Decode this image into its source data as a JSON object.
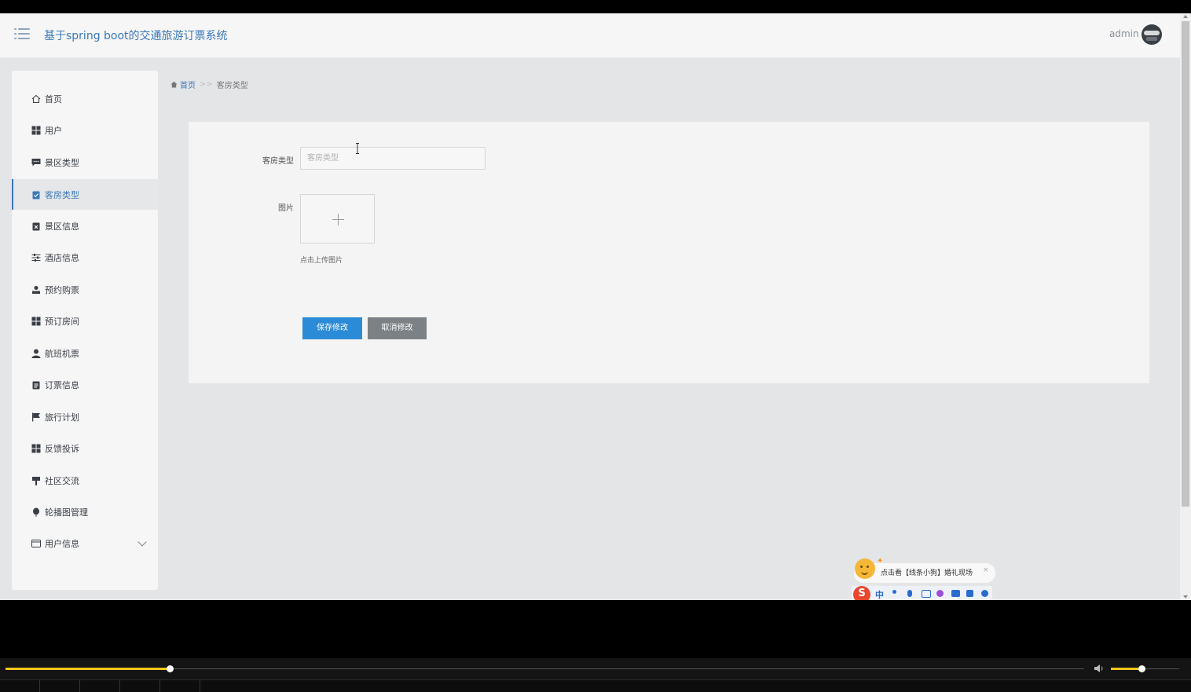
{
  "header": {
    "title": "基于spring boot的交通旅游订票系统",
    "user": "admin"
  },
  "sidebar": {
    "items": [
      {
        "label": "首页",
        "icon": "home-icon",
        "active": false
      },
      {
        "label": "用户",
        "icon": "grid-icon",
        "active": false
      },
      {
        "label": "景区类型",
        "icon": "comment-icon",
        "active": false
      },
      {
        "label": "客房类型",
        "icon": "clipboard-check-icon",
        "active": true
      },
      {
        "label": "景区信息",
        "icon": "clipboard-x-icon",
        "active": false
      },
      {
        "label": "酒店信息",
        "icon": "sliders-icon",
        "active": false
      },
      {
        "label": "预约购票",
        "icon": "user-stamp-icon",
        "active": false
      },
      {
        "label": "预订房间",
        "icon": "grid-icon",
        "active": false
      },
      {
        "label": "航班机票",
        "icon": "user-icon",
        "active": false
      },
      {
        "label": "订票信息",
        "icon": "clipboard-icon",
        "active": false
      },
      {
        "label": "旅行计划",
        "icon": "flag-icon",
        "active": false
      },
      {
        "label": "反馈投诉",
        "icon": "grid-icon",
        "active": false
      },
      {
        "label": "社区交流",
        "icon": "signpost-icon",
        "active": false
      },
      {
        "label": "轮播图管理",
        "icon": "balloon-icon",
        "active": false
      },
      {
        "label": "用户信息",
        "icon": "card-icon",
        "active": false
      }
    ]
  },
  "breadcrumb": {
    "home": "首页",
    "separator": ">>",
    "current": "客房类型"
  },
  "form": {
    "type_label": "客房类型",
    "type_placeholder": "客房类型",
    "image_label": "图片",
    "upload_hint": "点击上传图片",
    "save_label": "保存修改",
    "cancel_label": "取消修改"
  },
  "ime": {
    "popup_text": "点击看【线条小狗】婚礼现场",
    "close": "×",
    "mode": "中",
    "logo": "S"
  },
  "player": {
    "progress_fraction": 0.152,
    "volume_fraction": 0.45,
    "accent": "#f5c518"
  },
  "colors": {
    "accent": "#3a78b7",
    "save_button": "#2c8bd6",
    "cancel_button": "#7c8185"
  }
}
